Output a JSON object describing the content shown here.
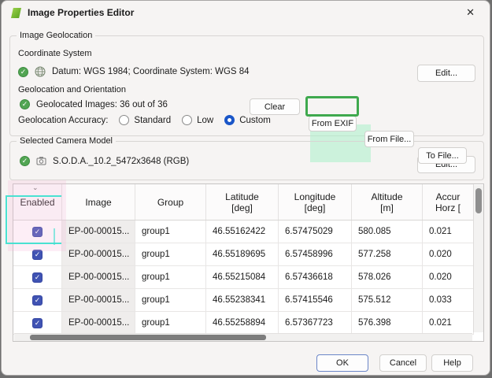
{
  "window": {
    "title": "Image Properties Editor"
  },
  "icons": {
    "close": "✕",
    "check": "✓",
    "chevron_down": "⌄"
  },
  "image_geolocation": {
    "group_title": "Image Geolocation",
    "coordinate_system": {
      "label": "Coordinate System",
      "value": "Datum: WGS 1984; Coordinate System: WGS 84",
      "edit_button": "Edit..."
    },
    "geolocation_orientation": {
      "label": "Geolocation and Orientation",
      "geolocated_images": "Geolocated Images: 36 out of 36",
      "buttons": {
        "clear": "Clear",
        "from_exif": "From EXIF",
        "from_file": "From File...",
        "to_file": "To File..."
      }
    },
    "accuracy": {
      "label": "Geolocation Accuracy:",
      "options": [
        {
          "label": "Standard",
          "selected": false
        },
        {
          "label": "Low",
          "selected": false
        },
        {
          "label": "Custom",
          "selected": true
        }
      ]
    }
  },
  "camera_model": {
    "group_title": "Selected Camera Model",
    "value": "S.O.D.A._10.2_5472x3648 (RGB)",
    "edit_button": "Edit..."
  },
  "table": {
    "headers": [
      [
        "Enabled"
      ],
      [
        "Image"
      ],
      [
        "Group"
      ],
      [
        "Latitude",
        "[deg]"
      ],
      [
        "Longitude",
        "[deg]"
      ],
      [
        "Altitude",
        "[m]"
      ],
      [
        "Accur",
        "Horz ["
      ]
    ],
    "rows": [
      {
        "enabled": true,
        "image": "EP-00-00015...",
        "group": "group1",
        "latitude": "46.55162422",
        "longitude": "6.57475029",
        "altitude": "580.085",
        "accuracy_horz": "0.021"
      },
      {
        "enabled": true,
        "image": "EP-00-00015...",
        "group": "group1",
        "latitude": "46.55189695",
        "longitude": "6.57458996",
        "altitude": "577.258",
        "accuracy_horz": "0.020"
      },
      {
        "enabled": true,
        "image": "EP-00-00015...",
        "group": "group1",
        "latitude": "46.55215084",
        "longitude": "6.57436618",
        "altitude": "578.026",
        "accuracy_horz": "0.020"
      },
      {
        "enabled": true,
        "image": "EP-00-00015...",
        "group": "group1",
        "latitude": "46.55238341",
        "longitude": "6.57415546",
        "altitude": "575.512",
        "accuracy_horz": "0.033"
      },
      {
        "enabled": true,
        "image": "EP-00-00015...",
        "group": "group1",
        "latitude": "46.55258894",
        "longitude": "6.57367723",
        "altitude": "576.398",
        "accuracy_horz": "0.021"
      }
    ]
  },
  "footer": {
    "ok": "OK",
    "cancel": "Cancel",
    "help": "Help"
  },
  "colors": {
    "status_green": "#52a553",
    "checkbox_blue": "#4053b3",
    "radio_blue": "#1a56c8",
    "highlight_border_green": "#3fa94e",
    "highlight_fill_mint": "#a9f0c9",
    "annotation_cyan": "#40e0d0",
    "annotation_pink": "#f6b2d8"
  }
}
